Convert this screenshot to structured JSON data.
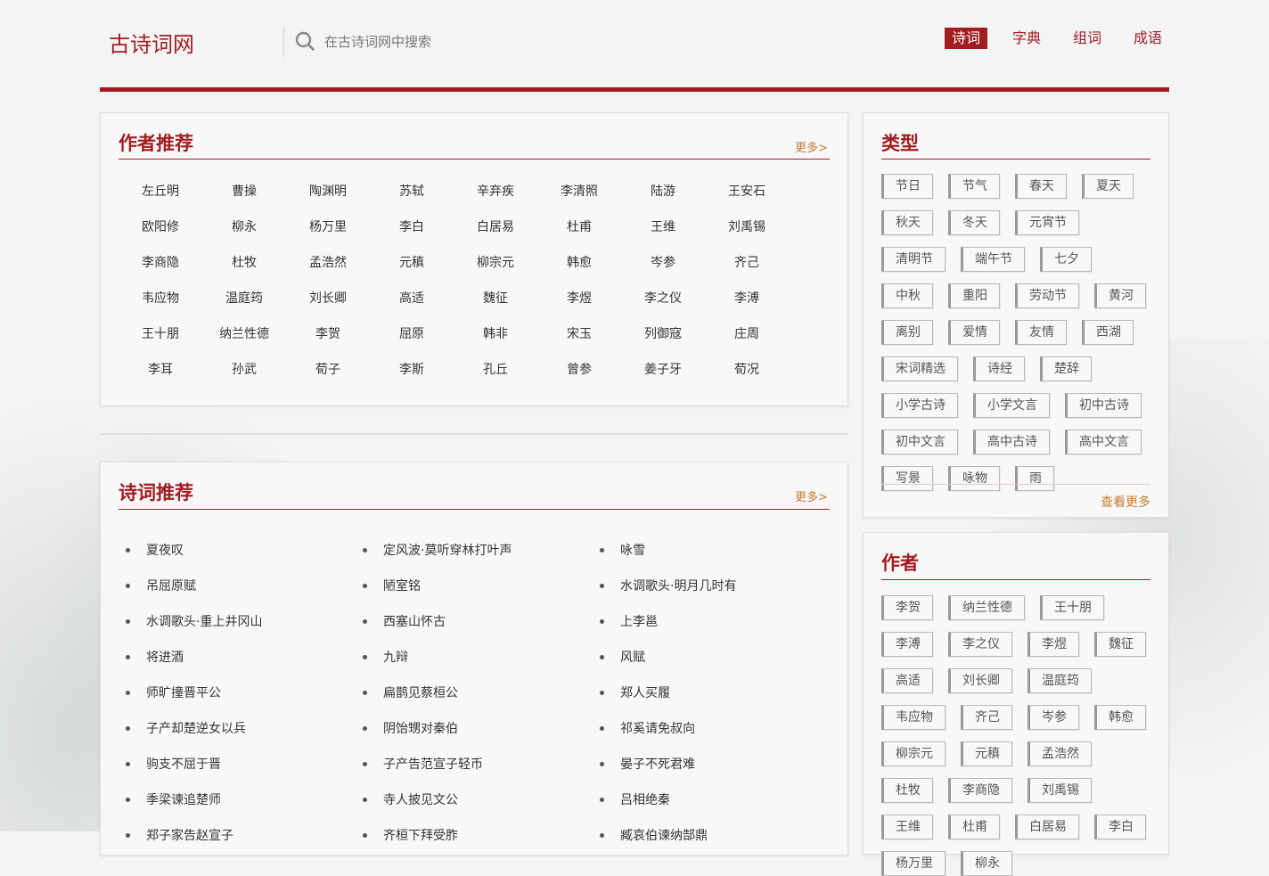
{
  "header": {
    "logo": "古诗词网",
    "search_placeholder": "在古诗词网中搜索",
    "nav": [
      "诗词",
      "字典",
      "组词",
      "成语"
    ]
  },
  "authors_panel": {
    "title": "作者推荐",
    "more": "更多>",
    "authors": [
      "左丘明",
      "曹操",
      "陶渊明",
      "苏轼",
      "辛弃疾",
      "李清照",
      "陆游",
      "王安石",
      "欧阳修",
      "柳永",
      "杨万里",
      "李白",
      "白居易",
      "杜甫",
      "王维",
      "刘禹锡",
      "李商隐",
      "杜牧",
      "孟浩然",
      "元稹",
      "柳宗元",
      "韩愈",
      "岑参",
      "齐己",
      "韦应物",
      "温庭筠",
      "刘长卿",
      "高适",
      "魏征",
      "李煜",
      "李之仪",
      "李溥",
      "王十朋",
      "纳兰性德",
      "李贺",
      "屈原",
      "韩非",
      "宋玉",
      "列御寇",
      "庄周",
      "李耳",
      "孙武",
      "荀子",
      "李斯",
      "孔丘",
      "曾参",
      "姜子牙",
      "荀况"
    ]
  },
  "poems_panel": {
    "title": "诗词推荐",
    "more": "更多>",
    "columns": [
      [
        "夏夜叹",
        "吊屈原赋",
        "水调歌头·重上井冈山",
        "将进酒",
        "师旷撞晋平公",
        "子产却楚逆女以兵",
        "驹支不屈于晋",
        "季梁谏追楚师",
        "郑子家告赵宣子"
      ],
      [
        "定风波·莫听穿林打叶声",
        "陋室铭",
        "西塞山怀古",
        "九辩",
        "扁鹊见蔡桓公",
        "阴饴甥对秦伯",
        "子产告范宣子轻币",
        "寺人披见文公",
        "齐桓下拜受胙"
      ],
      [
        "咏雪",
        "水调歌头·明月几时有",
        "上李邕",
        "风赋",
        "郑人买履",
        "祁奚请免叔向",
        "晏子不死君难",
        "吕相绝秦",
        "臧哀伯谏纳郜鼎"
      ]
    ]
  },
  "types_panel": {
    "title": "类型",
    "tags": [
      "节日",
      "节气",
      "春天",
      "夏天",
      "秋天",
      "冬天",
      "元宵节",
      "清明节",
      "端午节",
      "七夕",
      "中秋",
      "重阳",
      "劳动节",
      "黄河",
      "离别",
      "爱情",
      "友情",
      "西湖",
      "宋词精选",
      "诗经",
      "楚辞",
      "小学古诗",
      "小学文言",
      "初中古诗",
      "初中文言",
      "高中古诗",
      "高中文言",
      "写景",
      "咏物",
      "雨"
    ],
    "more": "查看更多"
  },
  "authors_side_panel": {
    "title": "作者",
    "tags": [
      "李贺",
      "纳兰性德",
      "王十朋",
      "李溥",
      "李之仪",
      "李煜",
      "魏征",
      "高适",
      "刘长卿",
      "温庭筠",
      "韦应物",
      "齐己",
      "岑参",
      "韩愈",
      "柳宗元",
      "元稹",
      "孟浩然",
      "杜牧",
      "李商隐",
      "刘禹锡",
      "王维",
      "杜甫",
      "白居易",
      "李白",
      "杨万里",
      "柳永"
    ]
  }
}
